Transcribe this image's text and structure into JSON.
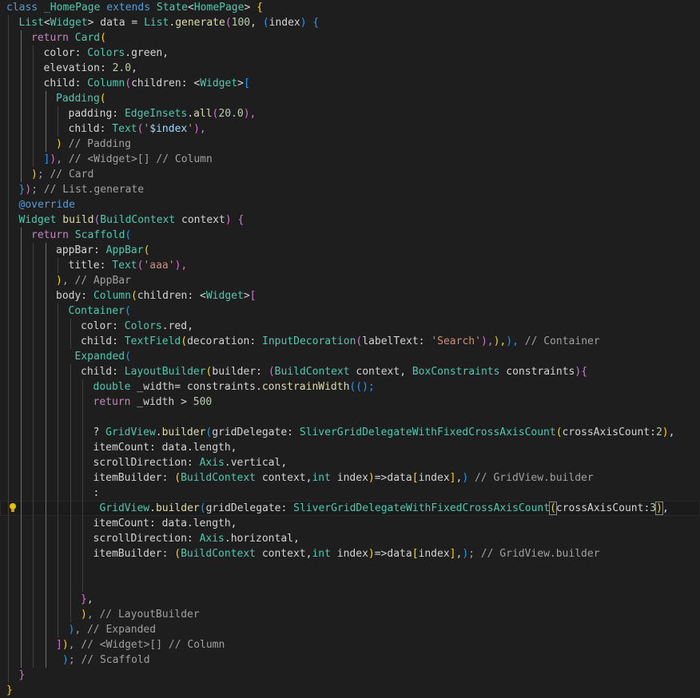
{
  "editor": {
    "lines": [
      {
        "indent": 0,
        "tokens": [
          [
            "class",
            "kw"
          ],
          [
            " ",
            "pl"
          ],
          [
            "_HomePage",
            "ty"
          ],
          [
            " extends ",
            "kw"
          ],
          [
            "State",
            "ty"
          ],
          [
            "<",
            "pl"
          ],
          [
            "HomePage",
            "ty"
          ],
          [
            "> ",
            "pl"
          ],
          [
            "{",
            "b1"
          ]
        ]
      },
      {
        "indent": 1,
        "tokens": [
          [
            "List",
            "ty"
          ],
          [
            "<",
            "pl"
          ],
          [
            "Widget",
            "ty"
          ],
          [
            "> data = ",
            "pl"
          ],
          [
            "List",
            "ty"
          ],
          [
            ".",
            "pl"
          ],
          [
            "generate",
            "fn"
          ],
          [
            "(",
            "b2"
          ],
          [
            "100",
            "nm"
          ],
          [
            ", ",
            "pl"
          ],
          [
            "(",
            "b3"
          ],
          [
            "index",
            "pl"
          ],
          [
            ") ",
            "b3"
          ],
          [
            "{",
            "b3"
          ]
        ]
      },
      {
        "indent": 2,
        "tokens": [
          [
            "return",
            "kc"
          ],
          [
            " ",
            "pl"
          ],
          [
            "Card",
            "ty"
          ],
          [
            "(",
            "b1"
          ]
        ]
      },
      {
        "indent": 3,
        "tokens": [
          [
            "color: ",
            "pl"
          ],
          [
            "Colors",
            "ty"
          ],
          [
            ".green,",
            "pl"
          ]
        ]
      },
      {
        "indent": 3,
        "tokens": [
          [
            "elevation: ",
            "pl"
          ],
          [
            "2.0",
            "nm"
          ],
          [
            ",",
            "pl"
          ]
        ]
      },
      {
        "indent": 3,
        "tokens": [
          [
            "child: ",
            "pl"
          ],
          [
            "Column",
            "ty"
          ],
          [
            "(",
            "b2"
          ],
          [
            "children: <",
            "pl"
          ],
          [
            "Widget",
            "ty"
          ],
          [
            ">",
            "pl"
          ],
          [
            "[",
            "b3"
          ]
        ]
      },
      {
        "indent": 4,
        "tokens": [
          [
            "Padding",
            "ty"
          ],
          [
            "(",
            "b1"
          ]
        ]
      },
      {
        "indent": 5,
        "tokens": [
          [
            "padding: ",
            "pl"
          ],
          [
            "EdgeInsets",
            "ty"
          ],
          [
            ".",
            "pl"
          ],
          [
            "all",
            "fn"
          ],
          [
            "(",
            "b2"
          ],
          [
            "20.0",
            "nm"
          ],
          [
            "),",
            "b2"
          ]
        ]
      },
      {
        "indent": 5,
        "tokens": [
          [
            "child: ",
            "pl"
          ],
          [
            "Text",
            "ty"
          ],
          [
            "(",
            "b2"
          ],
          [
            "'",
            "st"
          ],
          [
            "$index",
            "iv"
          ],
          [
            "'",
            "st"
          ],
          [
            "),",
            "b2"
          ]
        ]
      },
      {
        "indent": 4,
        "tokens": [
          [
            ")",
            "b1"
          ],
          [
            " // Padding",
            "cm"
          ]
        ]
      },
      {
        "indent": 3,
        "tokens": [
          [
            "]",
            "b3"
          ],
          [
            ")",
            "b2"
          ],
          [
            ", // <Widget>[] // Column",
            "cm"
          ]
        ]
      },
      {
        "indent": 2,
        "tokens": [
          [
            ")",
            "b1"
          ],
          [
            "; // Card",
            "cm"
          ]
        ]
      },
      {
        "indent": 1,
        "tokens": [
          [
            "}",
            "b3"
          ],
          [
            ")",
            "b2"
          ],
          [
            "; // List.generate",
            "cm"
          ]
        ]
      },
      {
        "indent": 1,
        "tokens": [
          [
            "@override",
            "kw"
          ]
        ]
      },
      {
        "indent": 1,
        "tokens": [
          [
            "Widget",
            "ty"
          ],
          [
            " ",
            "pl"
          ],
          [
            "build",
            "fn"
          ],
          [
            "(",
            "b2"
          ],
          [
            "BuildContext",
            "ty"
          ],
          [
            " context",
            "pl"
          ],
          [
            ") ",
            "b2"
          ],
          [
            "{",
            "b2"
          ]
        ]
      },
      {
        "indent": 2,
        "tokens": [
          [
            "return",
            "kc"
          ],
          [
            " ",
            "pl"
          ],
          [
            "Scaffold",
            "ty"
          ],
          [
            "(",
            "b3"
          ]
        ]
      },
      {
        "indent": 4,
        "tokens": [
          [
            "appBar: ",
            "pl"
          ],
          [
            "AppBar",
            "ty"
          ],
          [
            "(",
            "b1"
          ]
        ]
      },
      {
        "indent": 5,
        "tokens": [
          [
            "title: ",
            "pl"
          ],
          [
            "Text",
            "ty"
          ],
          [
            "(",
            "b2"
          ],
          [
            "'aaa'",
            "st"
          ],
          [
            "),",
            "b2"
          ]
        ]
      },
      {
        "indent": 4,
        "tokens": [
          [
            ")",
            "b1"
          ],
          [
            ", // AppBar",
            "cm"
          ]
        ]
      },
      {
        "indent": 4,
        "tokens": [
          [
            "body: ",
            "pl"
          ],
          [
            "Column",
            "ty"
          ],
          [
            "(",
            "b1"
          ],
          [
            "children: <",
            "pl"
          ],
          [
            "Widget",
            "ty"
          ],
          [
            ">",
            "pl"
          ],
          [
            "[",
            "b2"
          ]
        ]
      },
      {
        "indent": 5,
        "tokens": [
          [
            "Container",
            "ty"
          ],
          [
            "(",
            "b3"
          ]
        ]
      },
      {
        "indent": 6,
        "tokens": [
          [
            "color: ",
            "pl"
          ],
          [
            "Colors",
            "ty"
          ],
          [
            ".red,",
            "pl"
          ]
        ]
      },
      {
        "indent": 6,
        "tokens": [
          [
            "child: ",
            "pl"
          ],
          [
            "TextField",
            "ty"
          ],
          [
            "(",
            "b1"
          ],
          [
            "decoration: ",
            "pl"
          ],
          [
            "InputDecoration",
            "ty"
          ],
          [
            "(",
            "b2"
          ],
          [
            "labelText: ",
            "pl"
          ],
          [
            "'Search'",
            "st"
          ],
          [
            "),",
            "b2"
          ],
          [
            "),",
            "b1"
          ],
          [
            "), ",
            "b3"
          ],
          [
            "// Container",
            "cm"
          ]
        ]
      },
      {
        "indent": 5,
        "offset": 8,
        "tokens": [
          [
            "Expanded",
            "ty"
          ],
          [
            "(",
            "b3"
          ]
        ]
      },
      {
        "indent": 6,
        "tokens": [
          [
            "child: ",
            "pl"
          ],
          [
            "LayoutBuilder",
            "ty"
          ],
          [
            "(",
            "b1"
          ],
          [
            "builder: ",
            "pl"
          ],
          [
            "(",
            "b2"
          ],
          [
            "BuildContext",
            "ty"
          ],
          [
            " context, ",
            "pl"
          ],
          [
            "BoxConstraints",
            "ty"
          ],
          [
            " constraints",
            "pl"
          ],
          [
            ")",
            "b2"
          ],
          [
            "{",
            "b2"
          ]
        ]
      },
      {
        "indent": 7,
        "tokens": [
          [
            "double",
            "ty"
          ],
          [
            " _width= constraints.",
            "pl"
          ],
          [
            "constrainWidth",
            "fn"
          ],
          [
            "(",
            "b3"
          ],
          [
            "();",
            "b3"
          ]
        ]
      },
      {
        "indent": 7,
        "tokens": [
          [
            "return",
            "kc"
          ],
          [
            " _width > ",
            "pl"
          ],
          [
            "500",
            "nm"
          ]
        ]
      },
      {
        "indent": 7,
        "tokens": []
      },
      {
        "indent": 7,
        "tokens": [
          [
            "? ",
            "pl"
          ],
          [
            "GridView",
            "ty"
          ],
          [
            ".",
            "pl"
          ],
          [
            "builder",
            "fn"
          ],
          [
            "(",
            "b3"
          ],
          [
            "gridDelegate: ",
            "pl"
          ],
          [
            "SliverGridDelegateWithFixedCrossAxisCount",
            "ty"
          ],
          [
            "(",
            "b1"
          ],
          [
            "crossAxisCount:",
            "pl"
          ],
          [
            "2",
            "nm"
          ],
          [
            ")",
            "b1"
          ],
          [
            ",",
            "pl"
          ]
        ]
      },
      {
        "indent": 7,
        "tokens": [
          [
            "itemCount: data.length,",
            "pl"
          ]
        ]
      },
      {
        "indent": 7,
        "tokens": [
          [
            "scrollDirection: ",
            "pl"
          ],
          [
            "Axis",
            "ty"
          ],
          [
            ".vertical,",
            "pl"
          ]
        ]
      },
      {
        "indent": 7,
        "tokens": [
          [
            "itemBuilder: ",
            "pl"
          ],
          [
            "(",
            "b1"
          ],
          [
            "BuildContext",
            "ty"
          ],
          [
            " context,",
            "pl"
          ],
          [
            "int",
            "ty"
          ],
          [
            " index",
            "pl"
          ],
          [
            ")",
            "b1"
          ],
          [
            "=>data",
            "pl"
          ],
          [
            "[",
            "b1"
          ],
          [
            "index",
            "pl"
          ],
          [
            "]",
            "b1"
          ],
          [
            ",",
            "pl"
          ],
          [
            ")",
            "b3"
          ],
          [
            " // GridView.builder",
            "cm"
          ]
        ]
      },
      {
        "indent": 7,
        "tokens": [
          [
            ":",
            "pl"
          ]
        ]
      },
      {
        "indent": 7,
        "offset": 8,
        "highlight": true,
        "bulb": true,
        "tokens": [
          [
            "GridView",
            "ty"
          ],
          [
            ".",
            "pl"
          ],
          [
            "builder",
            "fn"
          ],
          [
            "(",
            "b3"
          ],
          [
            "gridDelegate: ",
            "pl"
          ],
          [
            "SliverGridDelegateWithFixedCrossAxisCount",
            "ty"
          ],
          [
            "(",
            "b1box"
          ],
          [
            "crossAxisCount:",
            "pl"
          ],
          [
            "3",
            "nm"
          ],
          [
            ")",
            "b1box"
          ],
          [
            ",",
            "pl"
          ]
        ]
      },
      {
        "indent": 7,
        "tokens": [
          [
            "itemCount: data.length,",
            "pl"
          ]
        ]
      },
      {
        "indent": 7,
        "tokens": [
          [
            "scrollDirection: ",
            "pl"
          ],
          [
            "Axis",
            "ty"
          ],
          [
            ".horizontal,",
            "pl"
          ]
        ]
      },
      {
        "indent": 7,
        "tokens": [
          [
            "itemBuilder: ",
            "pl"
          ],
          [
            "(",
            "b1"
          ],
          [
            "BuildContext",
            "ty"
          ],
          [
            " context,",
            "pl"
          ],
          [
            "int",
            "ty"
          ],
          [
            " index",
            "pl"
          ],
          [
            ")",
            "b1"
          ],
          [
            "=>data",
            "pl"
          ],
          [
            "[",
            "b1"
          ],
          [
            "index",
            "pl"
          ],
          [
            "]",
            "b1"
          ],
          [
            ",",
            "pl"
          ],
          [
            ")",
            "b3"
          ],
          [
            "; // GridView.builder",
            "cm"
          ]
        ]
      },
      {
        "indent": 7,
        "tokens": []
      },
      {
        "indent": 7,
        "tokens": []
      },
      {
        "indent": 6,
        "tokens": [
          [
            "}",
            "b2"
          ],
          [
            ",",
            "pl"
          ]
        ]
      },
      {
        "indent": 6,
        "tokens": [
          [
            ")",
            "b1"
          ],
          [
            ", // LayoutBuilder",
            "cm"
          ]
        ]
      },
      {
        "indent": 5,
        "tokens": [
          [
            ")",
            "b3"
          ],
          [
            ", // Expanded",
            "cm"
          ]
        ]
      },
      {
        "indent": 4,
        "tokens": [
          [
            "]",
            "b2"
          ],
          [
            ")",
            "b1"
          ],
          [
            ", // <Widget>[] // Column",
            "cm"
          ]
        ]
      },
      {
        "indent": 4,
        "offset": 8,
        "tokens": [
          [
            ")",
            "b3"
          ],
          [
            "; // Scaffold",
            "cm"
          ]
        ]
      },
      {
        "indent": 1,
        "tokens": [
          [
            "}",
            "b2"
          ]
        ]
      },
      {
        "indent": 0,
        "tokens": [
          [
            "}",
            "b1"
          ]
        ]
      }
    ]
  },
  "colors": {
    "background": "#1e1e1e",
    "line_highlight": "#1b1b1b",
    "plain": "#d4d4d4",
    "keyword": "#569cd6",
    "control_keyword": "#c586c0",
    "type": "#4ec9b0",
    "function": "#dcdcaa",
    "number": "#b5cea8",
    "string": "#ce9178",
    "interpolation": "#9cdcfe",
    "comment": "#a0a0a0",
    "bracket_gold": "#ffd700",
    "bracket_pink": "#da70d6",
    "bracket_blue": "#179fff",
    "indent_guide": "#404040",
    "active_indent_guide": "#707070",
    "lightbulb": "#e8c000"
  },
  "icons": {
    "lightbulb": "lightbulb-icon"
  }
}
